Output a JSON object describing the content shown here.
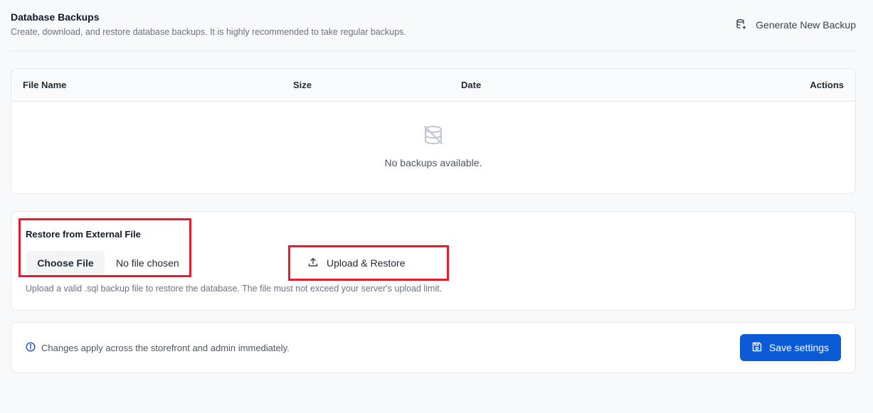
{
  "header": {
    "title": "Database Backups",
    "description": "Create, download, and restore database backups. It is highly recommended to take regular backups.",
    "generate_label": "Generate New Backup"
  },
  "table": {
    "columns": [
      "File Name",
      "Size",
      "Date",
      "Actions"
    ],
    "empty_text": "No backups available."
  },
  "restore": {
    "title": "Restore from External File",
    "choose_label": "Choose File",
    "file_status": "No file chosen",
    "upload_label": "Upload & Restore",
    "hint": "Upload a valid .sql backup file to restore the database. The file must not exceed your server's upload limit."
  },
  "footer": {
    "note": "Changes apply across the storefront and admin immediately.",
    "save_label": "Save settings"
  },
  "colors": {
    "primary": "#0b5bd7",
    "highlight": "#e11d2e",
    "info": "#1d4ed8"
  },
  "icons": {
    "generate": "database-plus-icon",
    "empty": "database-off-icon",
    "upload": "upload-icon",
    "info": "info-icon",
    "save": "floppy-disk-icon"
  }
}
